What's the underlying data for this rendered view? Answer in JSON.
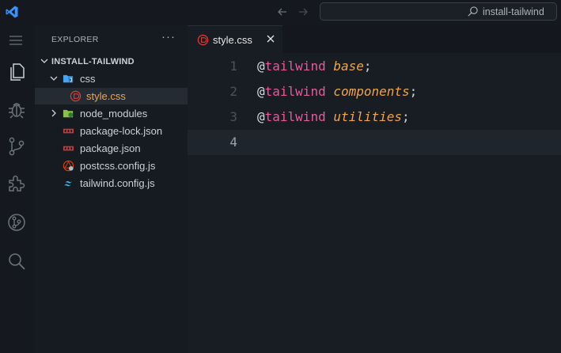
{
  "titlebar": {
    "search_text": "install-tailwind",
    "accent": "#3794ff"
  },
  "activity": [
    "explorer-icon",
    "debug-icon",
    "source-control-icon",
    "extensions-icon",
    "git-graph-icon",
    "search-icon"
  ],
  "sidebar": {
    "header": "EXPLORER",
    "more": "···",
    "root": "INSTALL-TAILWIND",
    "items": [
      {
        "label": "css",
        "icon": "css-folder-icon"
      },
      {
        "label": "style.css",
        "icon": "css-file-icon"
      },
      {
        "label": "node_modules",
        "icon": "node-folder-icon"
      },
      {
        "label": "package-lock.json",
        "icon": "npm-icon"
      },
      {
        "label": "package.json",
        "icon": "npm-icon"
      },
      {
        "label": "postcss.config.js",
        "icon": "postcss-icon"
      },
      {
        "label": "tailwind.config.js",
        "icon": "tailwind-icon"
      }
    ]
  },
  "editor": {
    "tab_label": "style.css",
    "lines": [
      {
        "num": "1",
        "at": "@",
        "kw": "tailwind",
        "val": "base",
        "punc": ";"
      },
      {
        "num": "2",
        "at": "@",
        "kw": "tailwind",
        "val": "components",
        "punc": ";"
      },
      {
        "num": "3",
        "at": "@",
        "kw": "tailwind",
        "val": "utilities",
        "punc": ";"
      },
      {
        "num": "4",
        "at": "",
        "kw": "",
        "val": "",
        "punc": ""
      }
    ]
  }
}
